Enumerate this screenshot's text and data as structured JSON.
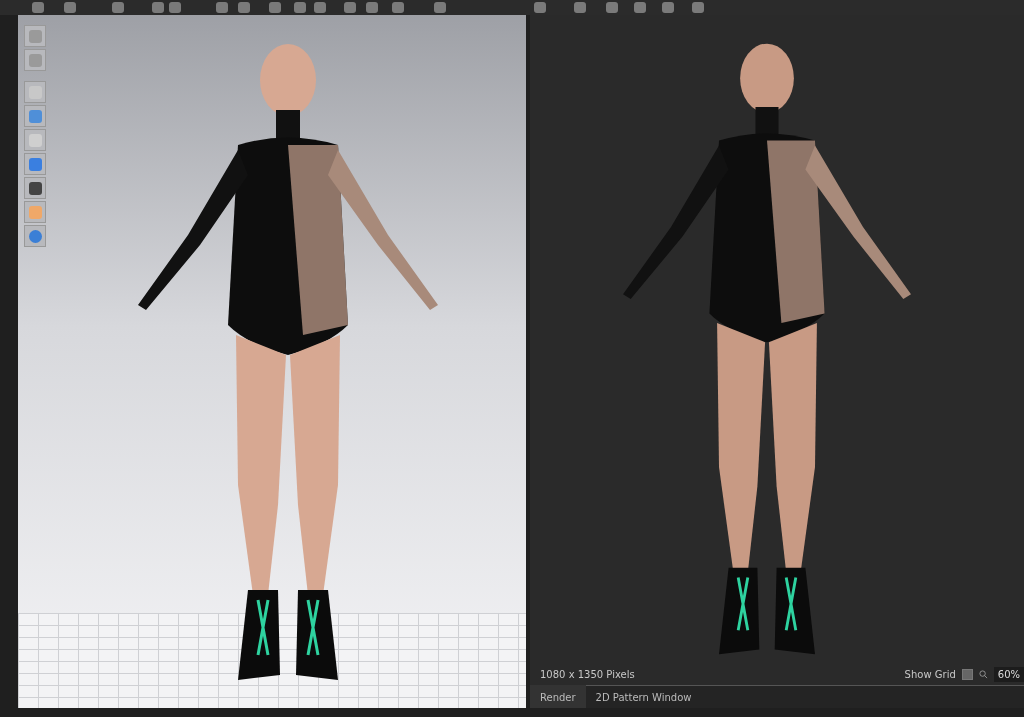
{
  "render_panel": {
    "resolution": "1080 x 1350 Pixels",
    "show_grid": {
      "label": "Show Grid",
      "checked": false
    },
    "zoom": "60%"
  },
  "tabs": [
    {
      "label": "Render",
      "selected": true
    },
    {
      "label": "2D Pattern Window",
      "selected": false
    }
  ]
}
